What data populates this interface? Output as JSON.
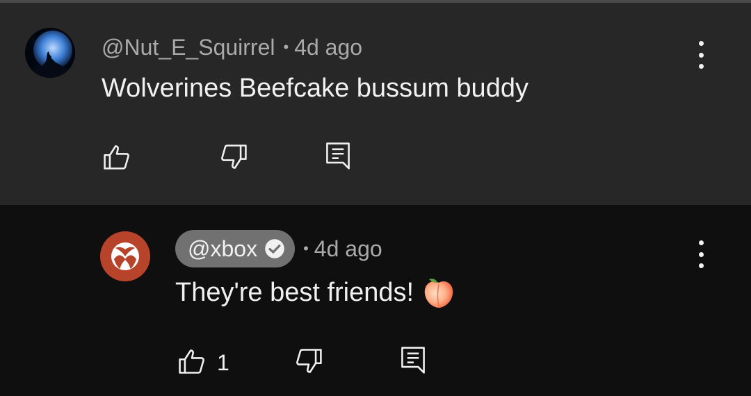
{
  "comments": [
    {
      "handle": "@Nut_E_Squirrel",
      "separator": "•",
      "time": "4d ago",
      "text": "Wolverines Beefcake bussum buddy",
      "avatar": "wolf-moon-avatar",
      "likes": ""
    }
  ],
  "reply": {
    "handle": "@xbox",
    "verified": true,
    "separator": "•",
    "time": "4d ago",
    "text": "They're best friends!",
    "emoji": "peach-emoji",
    "avatar": "xbox-logo-avatar",
    "likes": "1"
  },
  "icons": {
    "like": "thumbs-up-icon",
    "dislike": "thumbs-down-icon",
    "reply": "reply-icon",
    "more": "more-vert-icon"
  },
  "colors": {
    "top_background": "#272727",
    "reply_background": "#0f0f0f",
    "creator_pill": "#717171",
    "xbox_avatar": "#b8432b"
  }
}
